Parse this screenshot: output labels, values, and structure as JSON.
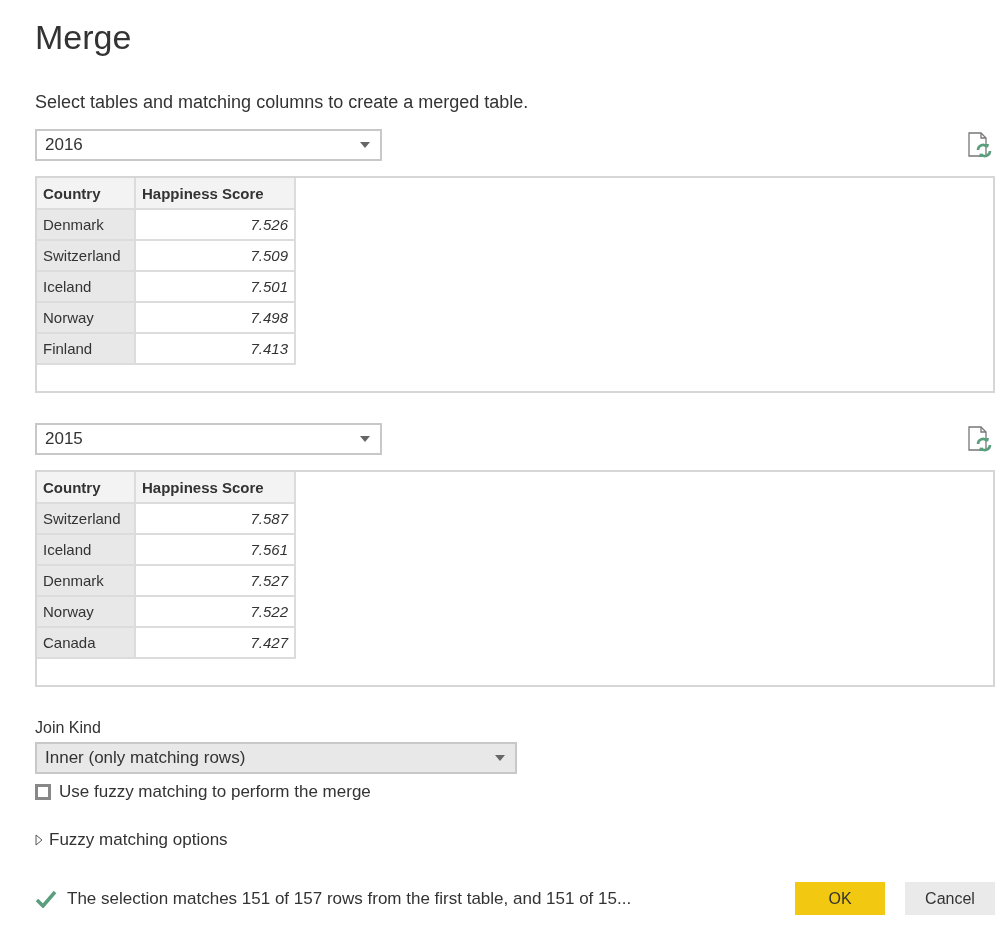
{
  "title": "Merge",
  "subtitle": "Select tables and matching columns to create a merged table.",
  "tables": [
    {
      "source": "2016",
      "columns": [
        "Country",
        "Happiness Score"
      ],
      "rows": [
        [
          "Denmark",
          "7.526"
        ],
        [
          "Switzerland",
          "7.509"
        ],
        [
          "Iceland",
          "7.501"
        ],
        [
          "Norway",
          "7.498"
        ],
        [
          "Finland",
          "7.413"
        ]
      ]
    },
    {
      "source": "2015",
      "columns": [
        "Country",
        "Happiness Score"
      ],
      "rows": [
        [
          "Switzerland",
          "7.587"
        ],
        [
          "Iceland",
          "7.561"
        ],
        [
          "Denmark",
          "7.527"
        ],
        [
          "Norway",
          "7.522"
        ],
        [
          "Canada",
          "7.427"
        ]
      ]
    }
  ],
  "join_kind": {
    "label": "Join Kind",
    "value": "Inner (only matching rows)"
  },
  "fuzzy_checkbox": {
    "label": "Use fuzzy matching to perform the merge",
    "checked": false
  },
  "fuzzy_options": {
    "label": "Fuzzy matching options",
    "expanded": false
  },
  "status": "The selection matches 151 of 157 rows from the first table, and 151 of 15...",
  "buttons": [
    {
      "label": "OK",
      "kind": "primary"
    },
    {
      "label": "Cancel",
      "kind": "secondary"
    }
  ]
}
